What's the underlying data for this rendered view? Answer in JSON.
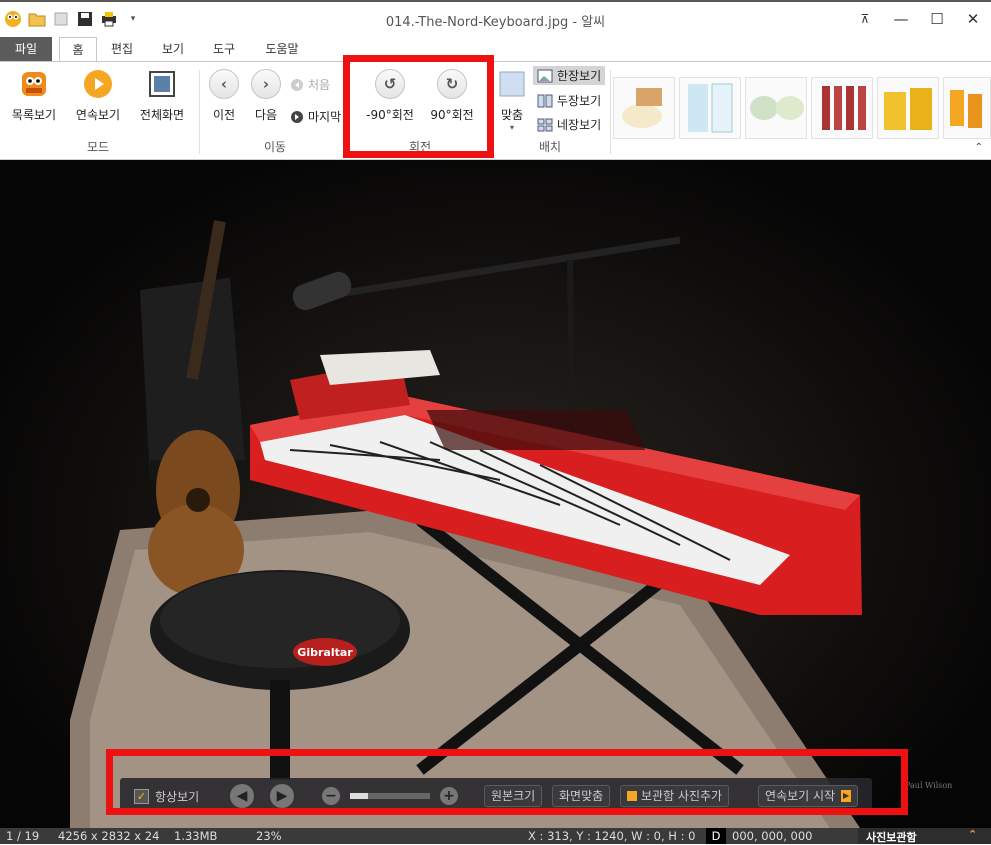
{
  "window": {
    "title": "014.-The-Nord-Keyboard.jpg - 알씨"
  },
  "tabs": [
    {
      "label": "파일"
    },
    {
      "label": "홈"
    },
    {
      "label": "편집"
    },
    {
      "label": "보기"
    },
    {
      "label": "도구"
    },
    {
      "label": "도움말"
    }
  ],
  "ribbon": {
    "mode": {
      "label": "모드",
      "buttons": [
        {
          "label": "목록보기"
        },
        {
          "label": "연속보기"
        },
        {
          "label": "전체화면"
        }
      ]
    },
    "move": {
      "label": "이동",
      "prev": "이전",
      "next": "다음",
      "first": "처음",
      "last": "마지막"
    },
    "rotate": {
      "label": "회전",
      "left": "-90°회전",
      "right": "90°회전"
    },
    "layout": {
      "label": "배치",
      "fit": "맞춤",
      "single": "한장보기",
      "double": "두장보기",
      "quad": "네장보기"
    }
  },
  "overlay": {
    "always_label": "항상보기",
    "original_size": "원본크기",
    "fit_screen": "화면맞춤",
    "add_to_archive": "보관함 사진추가",
    "slideshow": "연속보기 시작",
    "zoom_percent": 23
  },
  "photo": {
    "watermark": "Paul Wilson",
    "brand": "Gibraltar"
  },
  "status": {
    "index": "1 / 19",
    "dims": "4256 x 2832 x 24",
    "size": "1.33MB",
    "zoom": "23%",
    "coords": "X : 313, Y : 1240, W : 0, H : 0",
    "d_label": "D",
    "color": "000, 000, 000",
    "archive": "사진보관함"
  },
  "colors": {
    "highlight": "#ee1111",
    "statusbar": "#3a3a3a",
    "keyboard_red": "#d81e1e"
  }
}
